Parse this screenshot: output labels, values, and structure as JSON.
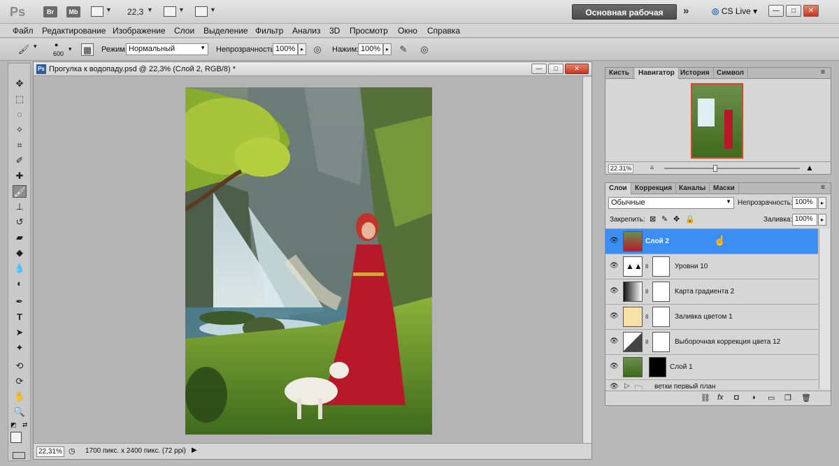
{
  "titlebar": {
    "app_logo": "Ps",
    "bridge": "Br",
    "minibridge": "Mb",
    "zoom": "22,3",
    "workspace": "Основная рабочая среда",
    "more": "»",
    "cslive": "CS Live ▾",
    "minimize": "—",
    "restore": "□",
    "close": "✕"
  },
  "menu": [
    "Файл",
    "Редактирование",
    "Изображение",
    "Слои",
    "Выделение",
    "Фильтр",
    "Анализ",
    "3D",
    "Просмотр",
    "Окно",
    "Справка"
  ],
  "options": {
    "brush_size": "600",
    "mode_label": "Режим:",
    "mode_value": "Нормальный",
    "opacity_label": "Непрозрачность:",
    "opacity_value": "100%",
    "flow_label": "Нажим:",
    "flow_value": "100%"
  },
  "document": {
    "title": "Прогулка к водопаду.psd @ 22,3% (Слой 2, RGB/8) *",
    "status_zoom": "22,31%",
    "status_info": "1700 пикс. x 2400 пикс. (72 ppi)"
  },
  "navigator": {
    "tabs": [
      "Кисть",
      "Навигатор",
      "История",
      "Символ"
    ],
    "active_tab": "Навигатор",
    "zoom": "22.31%"
  },
  "layers_panel": {
    "tabs": [
      "Слои",
      "Коррекция",
      "Каналы",
      "Маски"
    ],
    "blend_mode": "Обычные",
    "opacity_label": "Непрозрачность:",
    "opacity_value": "100%",
    "lock_label": "Закрепить:",
    "fill_label": "Заливка:",
    "fill_value": "100%",
    "layers": [
      {
        "name": "Слой 2",
        "selected": true
      },
      {
        "name": "Уровни 10",
        "selected": false
      },
      {
        "name": "Карта градиента 2",
        "selected": false
      },
      {
        "name": "Заливка цветом 1",
        "selected": false
      },
      {
        "name": "Выборочная коррекция цвета 12",
        "selected": false
      },
      {
        "name": "Слой 1",
        "selected": false
      },
      {
        "name": "ветки первый план",
        "selected": false
      }
    ]
  },
  "colors": {
    "selection": "#3d8ef2",
    "dress": "#b8192a",
    "foliage": "#7a9e2c",
    "water": "#dfeef3"
  }
}
